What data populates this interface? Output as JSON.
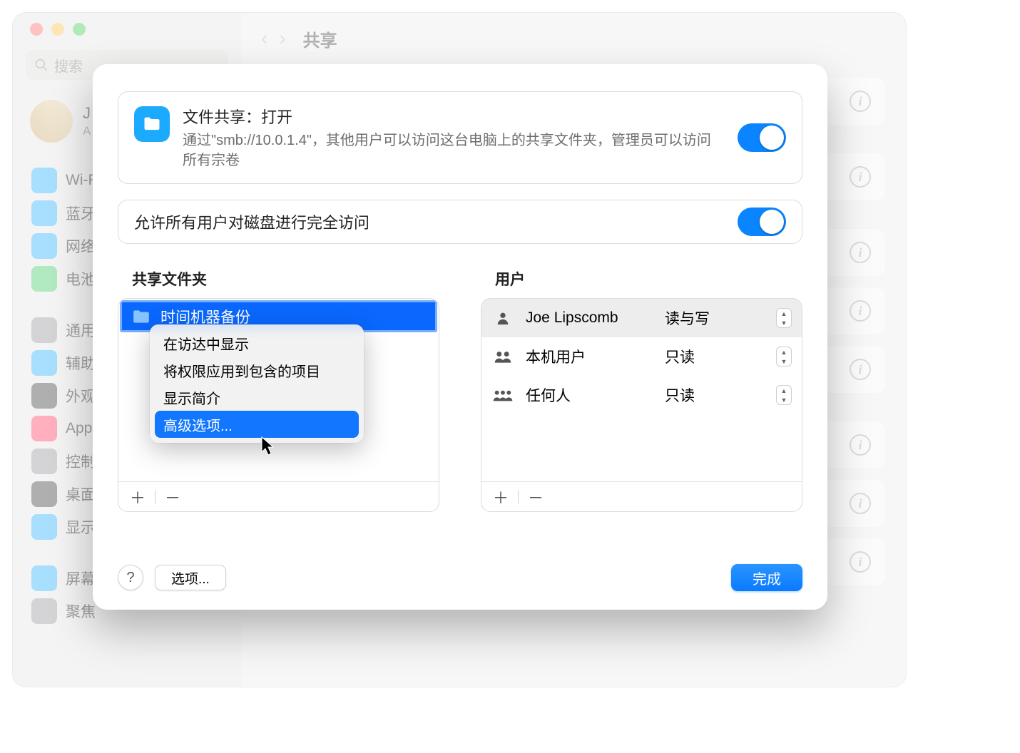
{
  "background": {
    "search_placeholder": "搜索",
    "user": {
      "name_initial": "J",
      "sub_initial": "A"
    },
    "nav_title": "共享",
    "sidebar_items": [
      {
        "label": "Wi-Fi",
        "icon": "#1baafd"
      },
      {
        "label": "蓝牙",
        "icon": "#1baafd"
      },
      {
        "label": "网络",
        "icon": "#1baafd"
      },
      {
        "label": "电池",
        "icon": "#34c759"
      },
      {
        "label": "通用",
        "icon": "#8e8e93"
      },
      {
        "label": "辅助功能",
        "icon": "#1baafd"
      },
      {
        "label": "外观",
        "icon": "#2f2f2f"
      },
      {
        "label": "Apple",
        "icon": "#ff2d55"
      },
      {
        "label": "控制中心",
        "icon": "#8e8e93"
      },
      {
        "label": "桌面",
        "icon": "#2f2f2f"
      },
      {
        "label": "显示器",
        "icon": "#1baafd"
      },
      {
        "label": "屏幕保护程序",
        "icon": "#1baafd"
      },
      {
        "label": "聚焦",
        "icon": "#8e8e93"
      }
    ]
  },
  "fileSharing": {
    "title": "文件共享：打开",
    "desc": "通过\"smb://10.0.1.4\"，其他用户可以访问这台电脑上的共享文件夹，管理员可以访问所有宗卷",
    "toggle": true
  },
  "fullAccess": {
    "label": "允许所有用户对磁盘进行完全访问",
    "toggle": true
  },
  "folders": {
    "label": "共享文件夹",
    "selected": "时间机器备份"
  },
  "users": {
    "label": "用户",
    "rows": [
      {
        "name": "Joe Lipscomb",
        "perm": "读与写",
        "icon": "person"
      },
      {
        "name": "本机用户",
        "perm": "只读",
        "icon": "group2"
      },
      {
        "name": "任何人",
        "perm": "只读",
        "icon": "group3"
      }
    ]
  },
  "contextMenu": {
    "items": [
      "在访达中显示",
      "将权限应用到包含的项目",
      "显示简介",
      "高级选项..."
    ],
    "highlighted": 3
  },
  "footer": {
    "help": "?",
    "options": "选项...",
    "done": "完成"
  }
}
